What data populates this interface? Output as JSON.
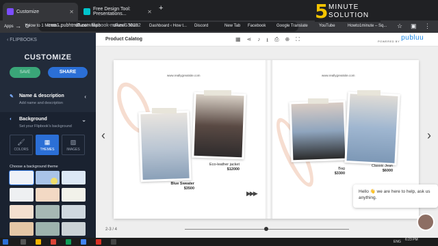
{
  "browser": {
    "tabs": [
      {
        "title": "Customize"
      },
      {
        "title": "Free Design Tool: Presentations..."
      }
    ],
    "url_prefix": "cms1.pubhtml5.com",
    "url_path": "/flipbook-maker/150192",
    "bookmarks": [
      "Apps",
      "How to 1 Minute -...",
      "cPanel - Main",
      "cPanel - Main",
      "Dashboard ‹ How t...",
      "Discord",
      "New Tab",
      "Facebook",
      "Google Translate",
      "YouTube",
      "Howto1minute – Sq..."
    ]
  },
  "watermark": {
    "number": "5",
    "line1": "MINUTE",
    "line2": "SOLUTION"
  },
  "sidebar": {
    "back_label": "FLIPBOOKS",
    "title": "CUSTOMIZE",
    "save_label": "SAVE",
    "share_label": "SHARE",
    "name_section": {
      "title": "Name & description",
      "subtitle": "Add name and description"
    },
    "bg_section": {
      "title": "Background",
      "subtitle": "Set your Flipbook's background"
    },
    "modes": [
      "COLORS",
      "THEMES",
      "IMAGES"
    ],
    "active_mode": "THEMES",
    "choose_label": "Choose a background theme",
    "swatch_colors": [
      "#eef1f7",
      "#a9c3e8",
      "#dce8f5",
      "#eef0f2",
      "#f3d9c4",
      "#f2f2ea",
      "#f3dfcf",
      "#a6b8b4",
      "#cfd8df",
      "#e5c7a6",
      "#9db3ae",
      "#cbd2d6"
    ]
  },
  "main": {
    "project_title": "Product Calatog",
    "powered_by": "POWERED BY",
    "powered_brand": "publuu",
    "page_indicator": "2-3 / 4",
    "slider_position": 0.5
  },
  "book": {
    "left_site": "www.reallygreatsite.com",
    "right_site": "www.reallygreatsite.com",
    "items": [
      {
        "name": "Blue Sweater",
        "price": "$3500"
      },
      {
        "name": "Eco-leather jacket",
        "price": "$12000"
      },
      {
        "name": "Bag",
        "price": "$3300"
      },
      {
        "name": "Classic Jean",
        "price": "$6000"
      }
    ]
  },
  "chat": {
    "message": "Hello 👋 we are here to help, ask us anything."
  },
  "taskbar": {
    "lang": "ENG",
    "time": "6:23 PM",
    "date": ""
  },
  "colors": {
    "accent": "#2b6fd6",
    "save": "#3aa678",
    "sidebar": "#222b3a"
  }
}
